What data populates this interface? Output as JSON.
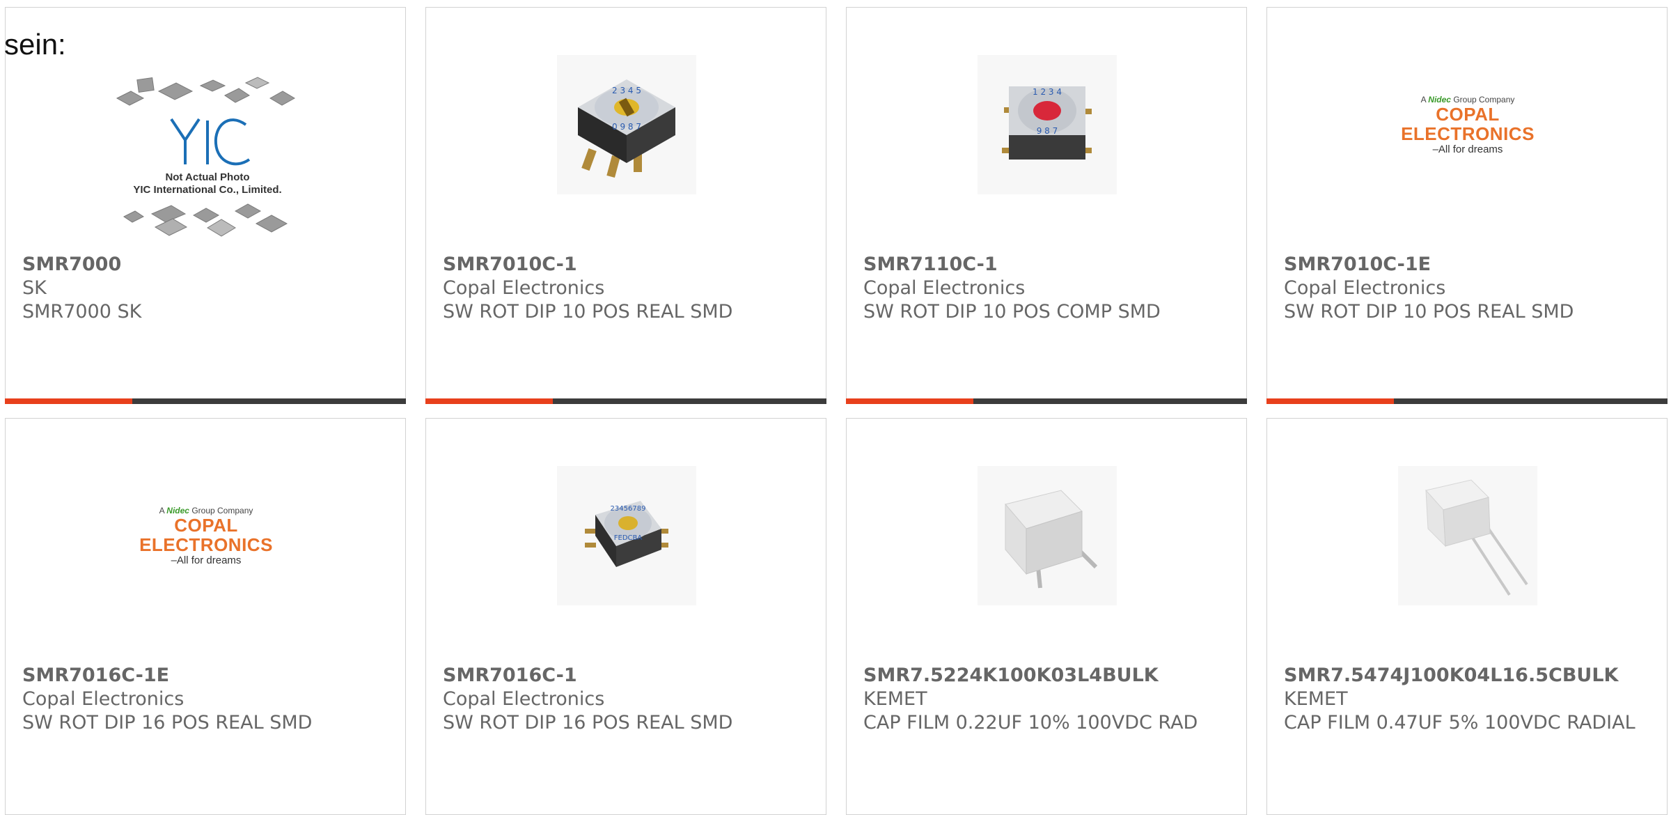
{
  "intro_text": "sein:",
  "colors": {
    "accent_bar": "#e8401c",
    "dark_bar": "#3c3c3c",
    "text": "#666666"
  },
  "products": [
    {
      "part_number": "SMR7000",
      "manufacturer": "SK",
      "description": "SMR7000 SK",
      "image": "placeholder",
      "image_text": {
        "line1": "Not Actual Photo",
        "line2": "YIC International Co., Limited.",
        "logo": "YIC"
      }
    },
    {
      "part_number": "SMR7010C-1",
      "manufacturer": "Copal Electronics",
      "description": "SW ROT DIP 10 POS REAL SMD",
      "image": "rotary-switch-yellow"
    },
    {
      "part_number": "SMR7110C-1",
      "manufacturer": "Copal Electronics",
      "description": "SW ROT DIP 10 POS COMP SMD",
      "image": "rotary-switch-red"
    },
    {
      "part_number": "SMR7010C-1E",
      "manufacturer": "Copal Electronics",
      "description": "SW ROT DIP 10 POS REAL SMD",
      "image": "copal-logo",
      "logo": {
        "top": "A Nidec Group Company",
        "brand_prefix": "Nidec",
        "brand_rest": " Group Company",
        "pre": "A ",
        "main": "COPAL ELECTRONICS",
        "tagline": "–All for dreams"
      }
    },
    {
      "part_number": "SMR7016C-1E",
      "manufacturer": "Copal Electronics",
      "description": "SW ROT DIP 16 POS REAL SMD",
      "image": "copal-logo",
      "logo": {
        "pre": "A ",
        "brand_prefix": "Nidec",
        "brand_rest": " Group Company",
        "main": "COPAL ELECTRONICS",
        "tagline": "–All for dreams"
      }
    },
    {
      "part_number": "SMR7016C-1",
      "manufacturer": "Copal Electronics",
      "description": "SW ROT DIP 16 POS REAL SMD",
      "image": "rotary-switch-16"
    },
    {
      "part_number": "SMR7.5224K100K03L4BULK",
      "manufacturer": "KEMET",
      "description": "CAP FILM 0.22UF 10% 100VDC RAD",
      "image": "film-capacitor-short"
    },
    {
      "part_number": "SMR7.5474J100K04L16.5CBULK",
      "manufacturer": "KEMET",
      "description": "CAP FILM 0.47UF 5% 100VDC RADIAL",
      "image": "film-capacitor-long"
    }
  ]
}
